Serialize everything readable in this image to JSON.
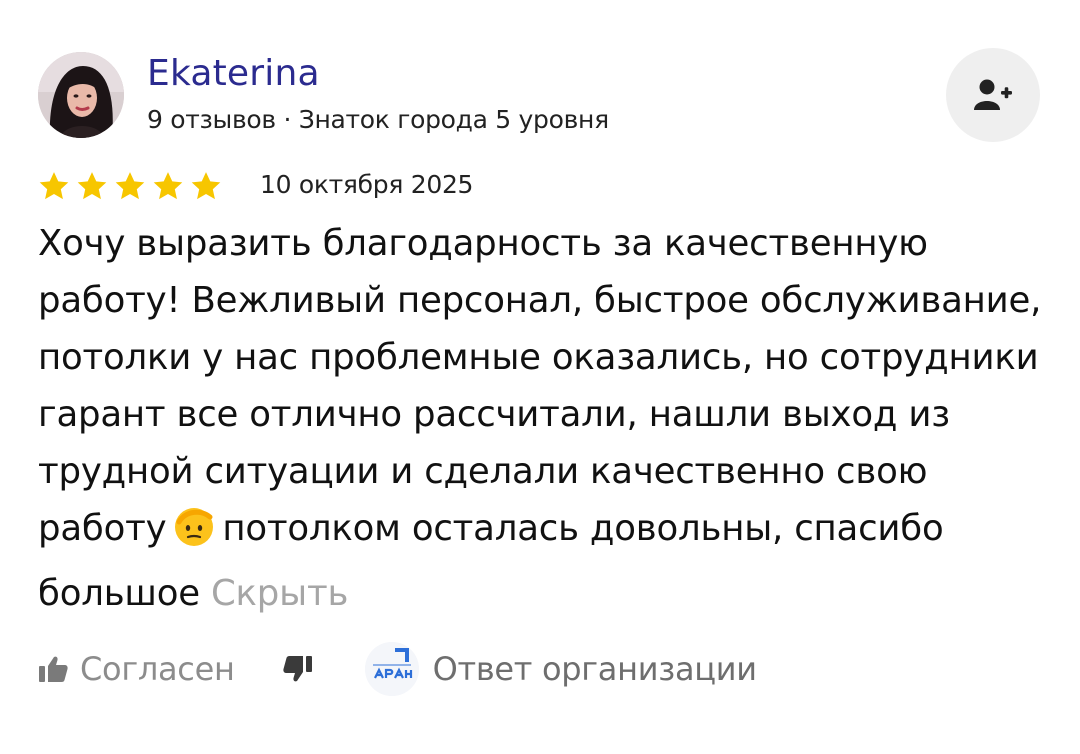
{
  "author": {
    "name": "Ekaterina",
    "meta": "9 отзывов · Знаток города 5 уровня"
  },
  "review": {
    "rating": 5,
    "rating_max": 5,
    "date": "10 октября 2025",
    "text_before_emoji": "Хочу выразить благодарность за качественную работу! Вежливый персонал, быстрое обслуживание, потолки у нас проблемные оказались, но сотрудники гарант все отлично рассчитали, нашли выход из трудной ситуации и сделали качественно свою работу",
    "emoji": "saluting-face-icon",
    "text_after_emoji": "потолком осталась довольны, спасибо большое",
    "hide_label": "Скрыть"
  },
  "actions": {
    "like_label": "Согласен",
    "org_reply_label": "Ответ организации"
  },
  "colors": {
    "name": "#2b2b8f",
    "star": "#f7c600",
    "muted": "#8c8c8c",
    "hide_link": "#a6a6a6",
    "button_bg": "#efefef"
  }
}
